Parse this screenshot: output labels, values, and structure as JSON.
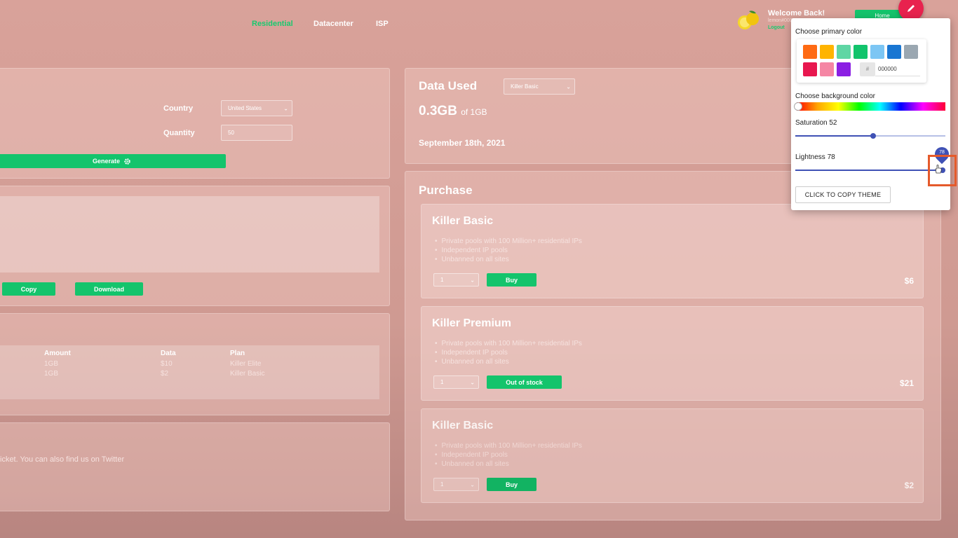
{
  "nav": {
    "residential": "Residential",
    "datacenter": "Datacenter",
    "isp": "ISP"
  },
  "user": {
    "welcome": "Welcome Back!",
    "username": "lemon#0001",
    "logout": "Logout",
    "home_label": "Home"
  },
  "generator": {
    "country_label": "Country",
    "country_value": "United States",
    "quantity_label": "Quantity",
    "quantity_value": "50",
    "generate_label": "Generate",
    "copy_label": "Copy",
    "download_label": "Download"
  },
  "orders": {
    "headers": [
      "Amount",
      "Data",
      "Plan"
    ],
    "rows": [
      [
        "1GB",
        "$10",
        "Killer Elite"
      ],
      [
        "1GB",
        "$2",
        "Killer Basic"
      ]
    ]
  },
  "support": {
    "text": "icket. You can also find us on Twitter"
  },
  "data_used": {
    "title": "Data Used",
    "plan_select": "Killer Basic",
    "amount": "0.3GB",
    "of_text": "of 1GB",
    "date": "September 18th, 2021"
  },
  "purchase": {
    "title": "Purchase",
    "cards": [
      {
        "name": "Killer Basic",
        "features": [
          "Private pools with 100 Million+ residential IPs",
          "Independent IP pools",
          "Unbanned on all sites"
        ],
        "qty": "1",
        "action": "Buy",
        "price": "$6"
      },
      {
        "name": "Killer Premium",
        "features": [
          "Private pools with 100 Million+ residential IPs",
          "Independent IP pools",
          "Unbanned on all sites"
        ],
        "qty": "1",
        "action": "Out of stock",
        "price": "$21"
      },
      {
        "name": "Killer Basic",
        "features": [
          "Private pools with 100 Million+ residential IPs",
          "Independent IP pools",
          "Unbanned on all sites"
        ],
        "qty": "1",
        "action": "Buy",
        "price": "$2"
      }
    ]
  },
  "theme": {
    "primary_label": "Choose primary color",
    "hex_value": "000000",
    "background_label": "Choose background color",
    "saturation_label": "Saturation 52",
    "saturation_value": 52,
    "lightness_label": "Lightness 78",
    "lightness_value": 78,
    "lightness_tooltip": "78",
    "copy_label": "CLICK TO COPY THEME",
    "swatches": [
      "#ff6a13",
      "#ffb400",
      "#5fd6a4",
      "#11c46c",
      "#7cc6f4",
      "#1976d2",
      "#9aa7b1",
      "#e8174f",
      "#f586a4",
      "#8b1fe3"
    ]
  }
}
